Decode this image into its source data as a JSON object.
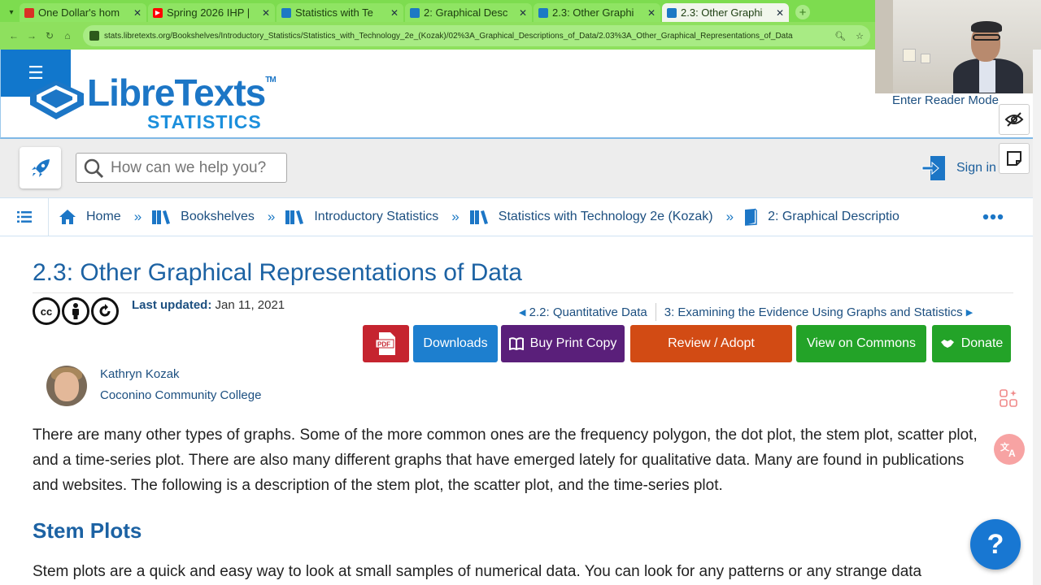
{
  "browser": {
    "tabs": [
      {
        "title": "One Dollar's hom",
        "favicon_color": "#d93025",
        "active": false
      },
      {
        "title": "Spring 2026 IHP |",
        "favicon_color": "#ff0000",
        "active": false
      },
      {
        "title": "Statistics with Te",
        "favicon_color": "#1c79c4",
        "active": false
      },
      {
        "title": "2: Graphical Desc",
        "favicon_color": "#1c79c4",
        "active": false
      },
      {
        "title": "2.3: Other Graphi",
        "favicon_color": "#1c79c4",
        "active": false
      },
      {
        "title": "2.3: Other Graphi",
        "favicon_color": "#1c79c4",
        "active": true
      }
    ],
    "url": "stats.libretexts.org/Bookshelves/Introductory_Statistics/Statistics_with_Technology_2e_(Kozak)/02%3A_Graphical_Descriptions_of_Data/2.03%3A_Other_Graphical_Representations_of_Data"
  },
  "header": {
    "logo_name": "LibreTexts",
    "logo_tm": "TM",
    "logo_sub": "STATISTICS",
    "reader_mode": "Enter Reader Mode",
    "menu_icon": "☰"
  },
  "toolbar": {
    "search_placeholder": "How can we help you?",
    "signin": "Sign in"
  },
  "breadcrumb": [
    {
      "label": "Home",
      "icon": "home-icon"
    },
    {
      "label": "Bookshelves",
      "icon": "books-icon"
    },
    {
      "label": "Introductory Statistics",
      "icon": "books-icon"
    },
    {
      "label": "Statistics with Technology 2e (Kozak)",
      "icon": "books-icon"
    },
    {
      "label": "2: Graphical Descriptio",
      "icon": "book-icon"
    }
  ],
  "page": {
    "title": "2.3: Other Graphical Representations of Data",
    "updated_label": "Last updated:",
    "updated_date": "Jan 11, 2021",
    "prev_link": "2.2: Quantitative Data",
    "next_link": "3: Examining the Evidence Using Graphs and Statistics",
    "license": [
      "cc",
      "by",
      "sa"
    ],
    "buttons": {
      "downloads": "Downloads",
      "buy": "Buy Print Copy",
      "review": "Review / Adopt",
      "commons": "View on Commons",
      "donate": "Donate"
    },
    "author": {
      "name": "Kathryn Kozak",
      "institution": "Coconino Community College"
    },
    "intro": "There are many other types of graphs. Some of the more common ones are the frequency polygon, the dot plot, the stem plot, scatter plot, and a time-series plot. There are also many different graphs that have emerged lately for qualitative data. Many are found in publications and websites. The following is a description of the stem plot, the scatter plot, and the time-series plot.",
    "section_heading": "Stem Plots",
    "section_text": "Stem plots are a quick and easy way to look at small samples of numerical data. You can look for any patterns or any strange data"
  },
  "help_label": "?",
  "colors": {
    "brand_blue": "#1c76c6",
    "title_blue": "#1c62a3",
    "pdf_red": "#c5242f",
    "downloads_blue": "#1d7fcf",
    "buy_purple": "#5a1f7a",
    "review_orange": "#d24b14",
    "commons_green": "#23a328",
    "chrome_green": "#7ddc4f"
  }
}
